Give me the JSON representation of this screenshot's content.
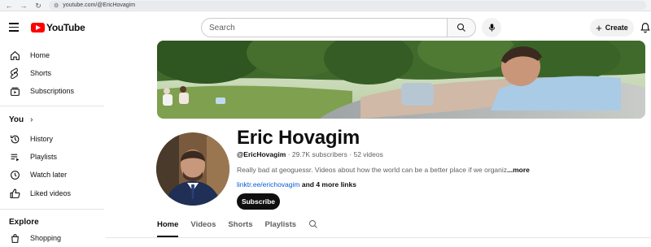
{
  "browser": {
    "url": "youtube.com/@EricHovagim"
  },
  "header": {
    "logo_text": "YouTube",
    "search_placeholder": "Search",
    "create_label": "Create"
  },
  "sidebar": {
    "main": [
      {
        "label": "Home",
        "icon": "home-icon"
      },
      {
        "label": "Shorts",
        "icon": "shorts-icon"
      },
      {
        "label": "Subscriptions",
        "icon": "subscriptions-icon"
      }
    ],
    "you_title": "You",
    "you": [
      {
        "label": "History",
        "icon": "history-icon"
      },
      {
        "label": "Playlists",
        "icon": "playlists-icon"
      },
      {
        "label": "Watch later",
        "icon": "watch-later-icon"
      },
      {
        "label": "Liked videos",
        "icon": "liked-videos-icon"
      }
    ],
    "explore_title": "Explore",
    "explore": [
      {
        "label": "Shopping",
        "icon": "shopping-icon"
      }
    ]
  },
  "channel": {
    "name": "Eric Hovagim",
    "handle": "@EricHovagim",
    "subscribers": "29.7K subscribers",
    "videos": "52 videos",
    "description": "Really bad at geoguessr. Videos about how the world can be a better place if we organiz",
    "more_label": "...more",
    "link_text": "linktr.ee/erichovagim",
    "more_links": "and 4 more links",
    "subscribe_label": "Subscribe"
  },
  "tabs": [
    {
      "label": "Home",
      "active": true
    },
    {
      "label": "Videos",
      "active": false
    },
    {
      "label": "Shorts",
      "active": false
    },
    {
      "label": "Playlists",
      "active": false
    }
  ],
  "colors": {
    "brand_red": "#ff0000",
    "link_blue": "#065fd4",
    "text": "#0f0f0f",
    "muted": "#606060"
  }
}
